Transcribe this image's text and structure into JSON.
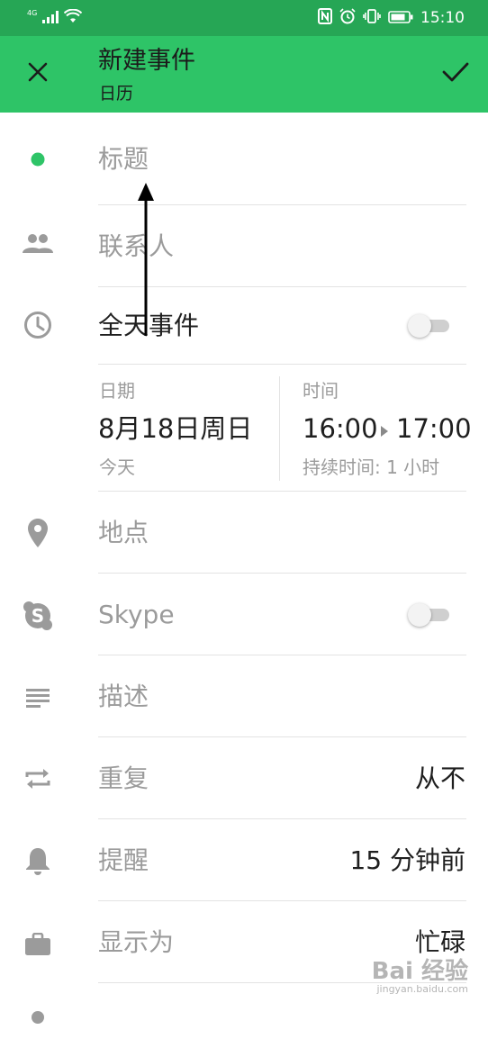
{
  "status_bar": {
    "network": "4G",
    "time": "15:10"
  },
  "app_bar": {
    "title": "新建事件",
    "subtitle": "日历",
    "close_icon": "close-icon",
    "save_icon": "check-icon"
  },
  "form": {
    "title_placeholder": "标题",
    "calendar_color": "#2ec467",
    "contacts_label": "联系人",
    "all_day_label": "全天事件",
    "all_day_enabled": false,
    "date": {
      "label": "日期",
      "value": "8月18日周日",
      "sub": "今天"
    },
    "time": {
      "label": "时间",
      "start": "16:00",
      "end": "17:00",
      "duration": "持续时间: 1 小时"
    },
    "location_label": "地点",
    "skype_label": "Skype",
    "skype_enabled": false,
    "description_label": "描述",
    "repeat": {
      "label": "重复",
      "value": "从不"
    },
    "reminder": {
      "label": "提醒",
      "value": "15 分钟前"
    },
    "show_as": {
      "label": "显示为",
      "value": "忙碌"
    }
  },
  "watermark": {
    "main": "Bai 经验",
    "url": "jingyan.baidu.com"
  },
  "colors": {
    "status_bar": "#26a655",
    "app_bar": "#2ec467",
    "icon_gray": "#9b9b9b"
  }
}
